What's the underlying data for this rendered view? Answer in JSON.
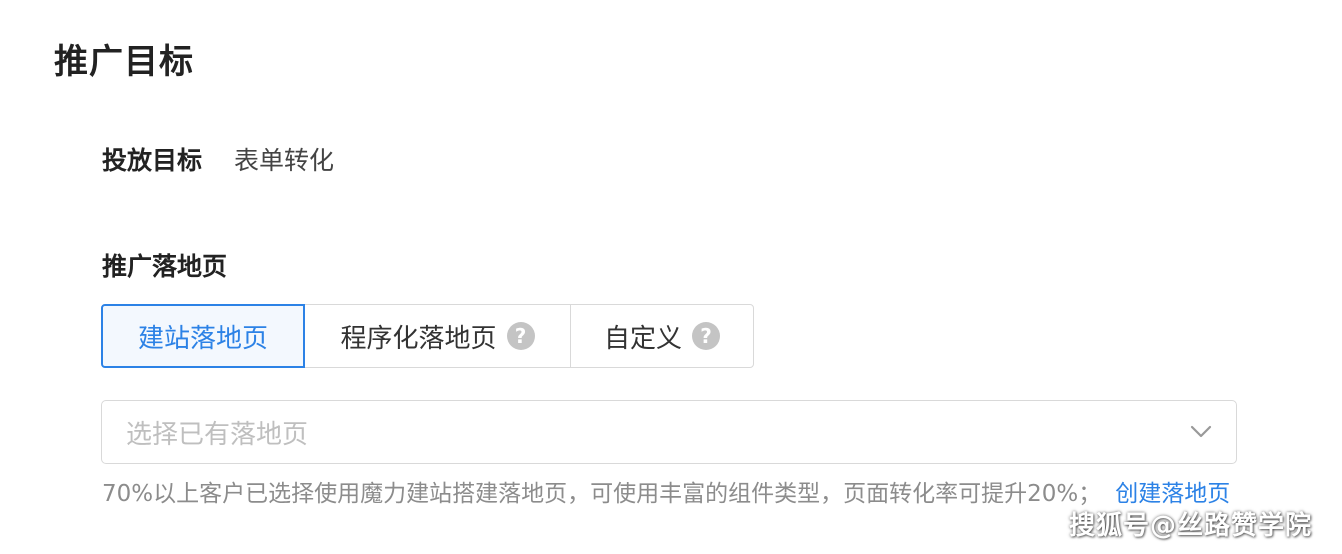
{
  "page_title": "推广目标",
  "goal": {
    "label": "投放目标",
    "value": "表单转化"
  },
  "landing_page": {
    "label": "推广落地页",
    "tabs": [
      {
        "label": "建站落地页",
        "active": true,
        "has_help": false
      },
      {
        "label": "程序化落地页",
        "active": false,
        "has_help": true
      },
      {
        "label": "自定义",
        "active": false,
        "has_help": true
      }
    ],
    "help_icon_glyph": "?",
    "select_placeholder": "选择已有落地页",
    "hint_text": "70%以上客户已选择使用魔力建站搭建落地页，可使用丰富的组件类型，页面转化率可提升20%；",
    "hint_link": "创建落地页"
  },
  "watermark": "搜狐号@丝路赞学院",
  "colors": {
    "accent": "#2c82e6",
    "active_tab_bg": "#f3f8fe",
    "border": "#d9d9d9",
    "placeholder": "#bfbfbf",
    "hint": "#8c8c8c"
  },
  "icons": {
    "help": "question-circle-icon",
    "dropdown": "chevron-down-icon"
  }
}
